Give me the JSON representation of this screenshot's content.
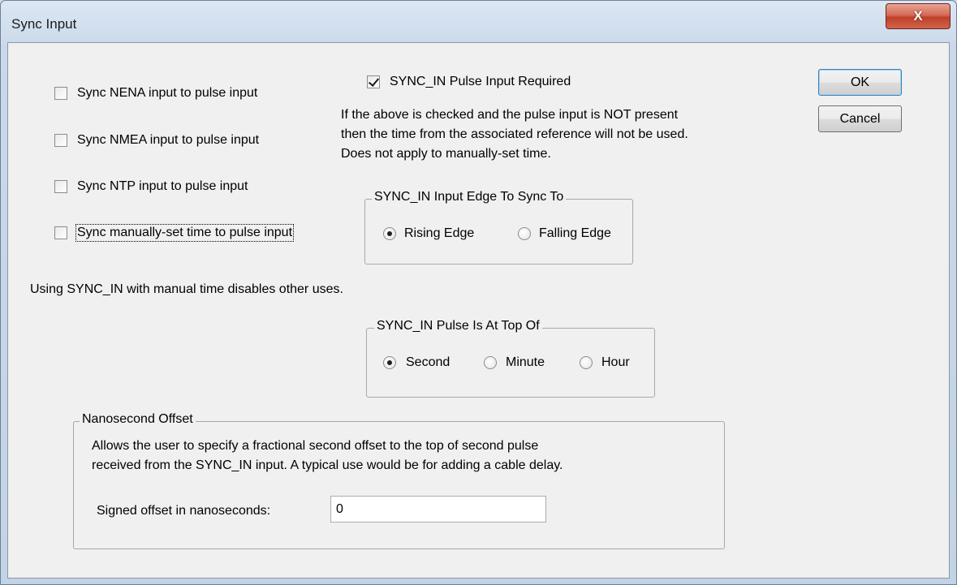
{
  "window": {
    "title": "Sync Input",
    "close_label": "X"
  },
  "sync_options": [
    {
      "label": "Sync NENA input to pulse input",
      "checked": false
    },
    {
      "label": "Sync NMEA input to pulse input",
      "checked": false
    },
    {
      "label": "Sync NTP input to pulse input",
      "checked": false
    },
    {
      "label": "Sync manually-set time to pulse input",
      "checked": false
    }
  ],
  "pulse_required": {
    "label": "SYNC_IN Pulse Input Required",
    "checked": true,
    "note_line1": "If the above is checked and the pulse input is NOT present",
    "note_line2": "then the time from the associated reference will not be used.",
    "note_line3": "Does not apply to manually-set time."
  },
  "edge_group": {
    "legend": "SYNC_IN Input Edge To Sync To",
    "options": [
      {
        "label": "Rising Edge",
        "selected": true
      },
      {
        "label": "Falling Edge",
        "selected": false
      }
    ]
  },
  "manual_note": "Using SYNC_IN with manual time disables other uses.",
  "top_of_group": {
    "legend": "SYNC_IN Pulse Is At Top Of",
    "options": [
      {
        "label": "Second",
        "selected": true
      },
      {
        "label": "Minute",
        "selected": false
      },
      {
        "label": "Hour",
        "selected": false
      }
    ]
  },
  "offset_group": {
    "legend": "Nanosecond Offset",
    "desc_line1": "Allows the user to specify a fractional second offset to the top of second pulse",
    "desc_line2": "received from the SYNC_IN input. A typical use would be for adding a cable delay.",
    "field_label": "Signed offset in nanoseconds:",
    "field_value": "0"
  },
  "buttons": {
    "ok": "OK",
    "cancel": "Cancel"
  }
}
